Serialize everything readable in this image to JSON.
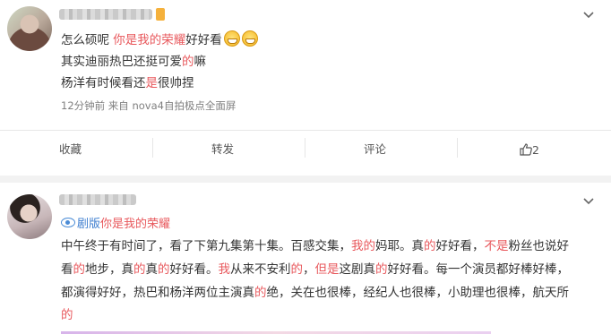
{
  "post1": {
    "line1": {
      "text1": "怎么硕呢 ",
      "red1": "你是我的荣耀",
      "text2": "好好看"
    },
    "line2": {
      "text1": "其实迪丽热巴还挺可爱",
      "red1": "的",
      "text2": "嘛"
    },
    "line3": {
      "text1": "杨洋有时候看还",
      "red1": "是",
      "text2": "很帅捏"
    },
    "meta": "12分钟前  来自 nova4自拍极点全面屏",
    "actions": {
      "collect": "收藏",
      "repost": "转发",
      "comment": "评论",
      "like_count": "2"
    }
  },
  "post2": {
    "source": {
      "prefix": "剧版",
      "title": "你是我的荣耀"
    },
    "body": {
      "r1": [
        "中午终于有时间了，看了下第九集第十集。百感交集，",
        "我的",
        "妈耶。真",
        "的",
        "好好看，",
        "不是",
        "粉丝也说好"
      ],
      "r2": [
        "看",
        "的",
        "地步，真",
        "的",
        "真",
        "的",
        "好好看。",
        "我",
        "从来不安利",
        "的",
        "，",
        "但是",
        "这剧真",
        "的",
        "好好看。每一个演员都好棒好棒，"
      ],
      "r3": [
        "都演得好好，热巴和杨洋两位主演真",
        "的",
        "绝，关在也很棒，经纪人也很棒，小助理也很棒，航天所"
      ],
      "r4": "的"
    }
  },
  "icons": {
    "menu": "chevron-down-icon",
    "like": "thumbs-up-icon",
    "source": "eye-icon",
    "emoji": "grin-emoji-icon"
  },
  "colors": {
    "accent": "#e8585c",
    "link": "#3f7fd0",
    "divider": "#e8e8e8"
  }
}
